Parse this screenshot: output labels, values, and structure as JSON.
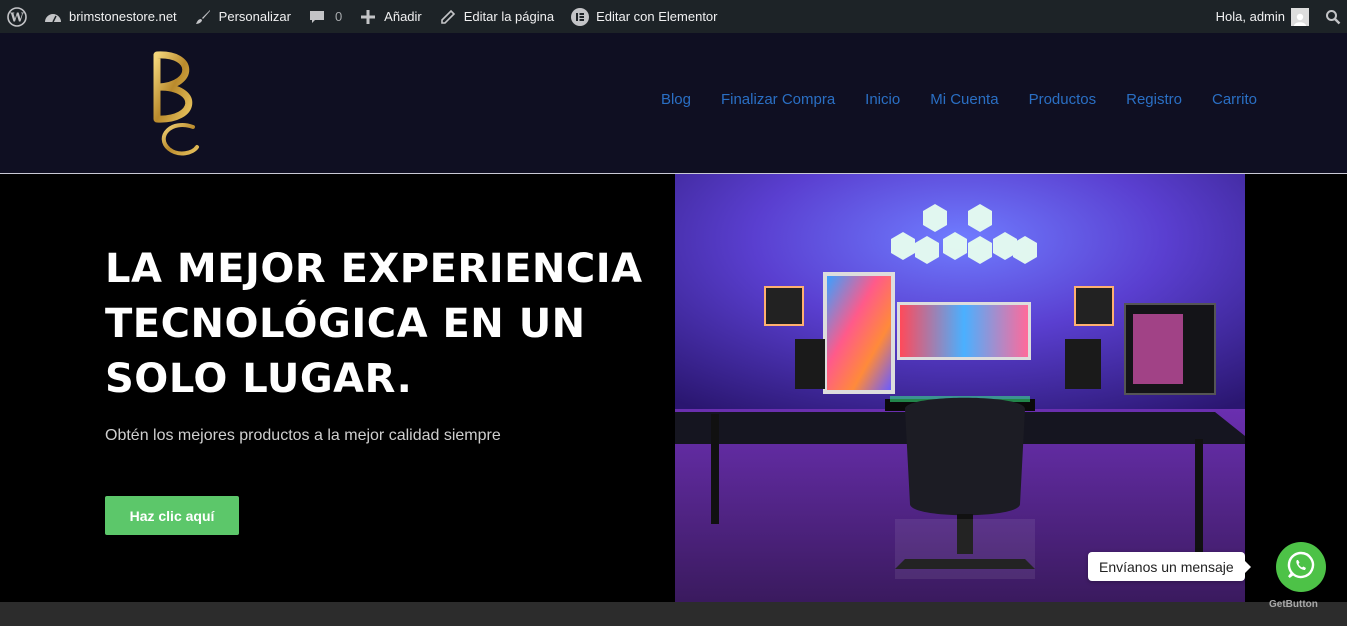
{
  "adminbar": {
    "site_name": "brimstonestore.net",
    "customize": "Personalizar",
    "comments_count": "0",
    "add_new": "Añadir",
    "edit_page": "Editar la página",
    "edit_elementor": "Editar con Elementor",
    "greeting": "Hola, admin"
  },
  "nav": {
    "items": [
      "Blog",
      "Finalizar Compra",
      "Inicio",
      "Mi Cuenta",
      "Productos",
      "Registro",
      "Carrito"
    ]
  },
  "hero": {
    "title_line1": "LA MEJOR EXPERIENCIA",
    "title_line2": "TECNOLÓGICA EN UN",
    "title_line3": "SOLO LUGAR.",
    "subtitle": "Obtén los mejores productos a la mejor calidad siempre",
    "cta": "Haz clic aquí"
  },
  "whatsapp": {
    "bubble": "Envíanos un mensaje",
    "credit": "GetButton"
  },
  "colors": {
    "adminbar_bg": "#1d2327",
    "header_bg": "#0f0f22",
    "nav_link": "#2a6fc4",
    "cta_bg": "#5cc76a",
    "whatsapp": "#4dc247"
  }
}
